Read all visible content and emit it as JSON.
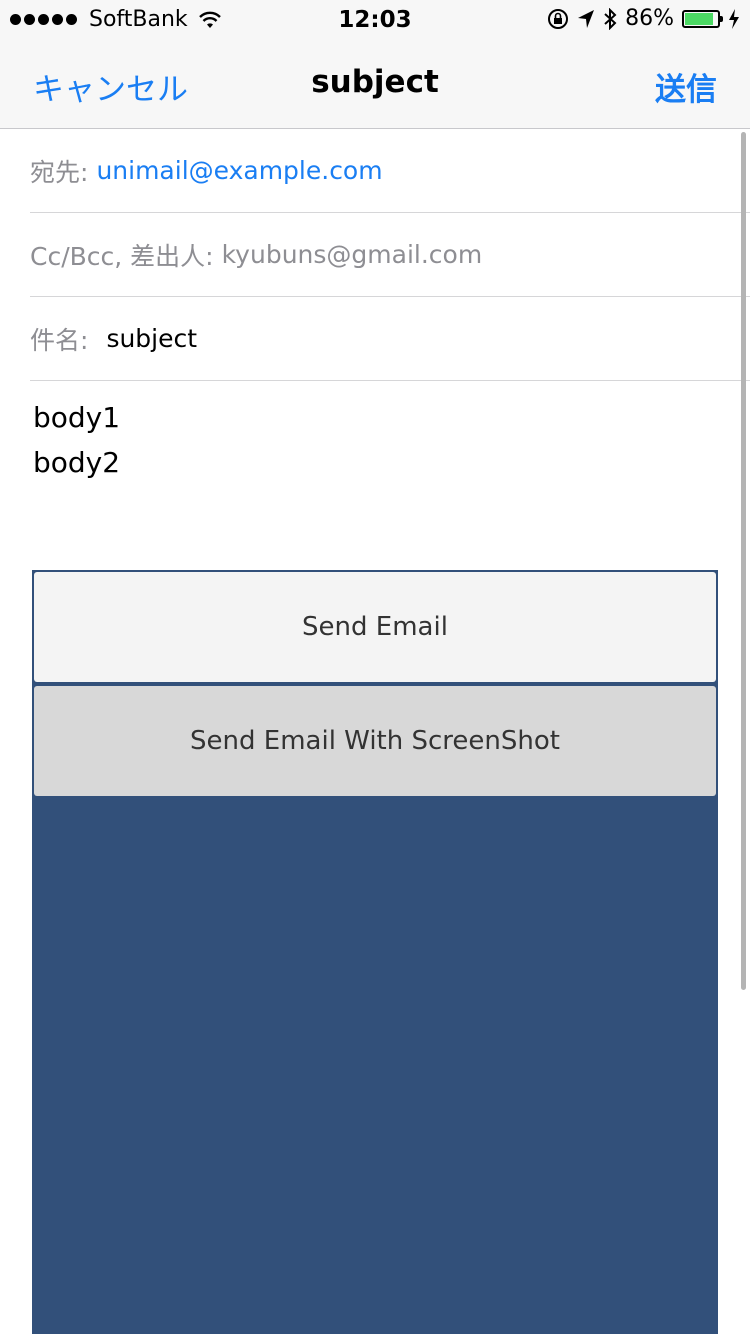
{
  "status_bar": {
    "carrier": "SoftBank",
    "time": "12:03",
    "battery": "86%",
    "battery_level": 0.86,
    "icons": [
      "wifi-icon",
      "orientation-lock-icon",
      "location-arrow-icon",
      "bluetooth-icon",
      "battery-icon",
      "charging-bolt-icon"
    ]
  },
  "nav": {
    "cancel": "キャンセル",
    "title": "subject",
    "send": "送信"
  },
  "fields": {
    "to_label": "宛先:",
    "to_value": "unimail@example.com",
    "cc_label": "Cc/Bcc, 差出人:",
    "cc_value": "kyubuns@gmail.com",
    "subject_label": "件名:",
    "subject_value": "subject"
  },
  "body": {
    "line1": "body1",
    "line2": "body2"
  },
  "panel": {
    "button1": "Send Email",
    "button2": "Send Email With ScreenShot",
    "background": "#32507a"
  },
  "colors": {
    "accent": "#1a7ef3",
    "battery": "#4cd964"
  }
}
